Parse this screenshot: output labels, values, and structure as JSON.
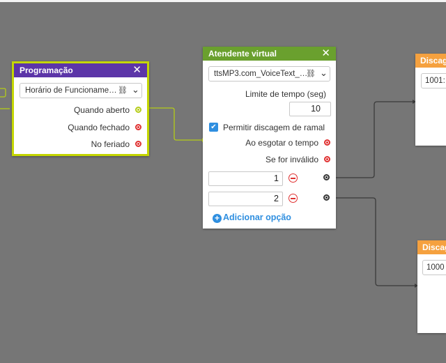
{
  "colors": {
    "canvas": "#767676",
    "programacao_header": "#5c35a8",
    "programacao_border": "#c4d600",
    "atendente_header": "#6aa02e",
    "discagem_header": "#f5a13f",
    "wire_green": "#b5cc18",
    "wire_dark": "#3b3b3b",
    "port_red": "#e03030",
    "link_blue": "#2f8fe0"
  },
  "programacao": {
    "title": "Programação",
    "close_icon": "close-icon",
    "select_value": "Horário de Funcioname…",
    "outputs": [
      "Quando aberto",
      "Quando fechado",
      "No feriado"
    ]
  },
  "atendente": {
    "title": "Atendente virtual",
    "close_icon": "close-icon",
    "select_value": "ttsMP3.com_VoiceText_…",
    "limit_label": "Limite de tempo (seg)",
    "limit_value": "10",
    "checkbox_label": "Permitir discagem de ramal",
    "checkbox_checked": true,
    "outputs": [
      "Ao esgotar o tempo",
      "Se for inválido"
    ],
    "options": [
      "1",
      "2"
    ],
    "add_option_label": "Adicionar opção"
  },
  "discagem_1": {
    "title": "Discag",
    "select_value": "1001:"
  },
  "discagem_2": {
    "title": "Discag",
    "select_value": "1000"
  }
}
